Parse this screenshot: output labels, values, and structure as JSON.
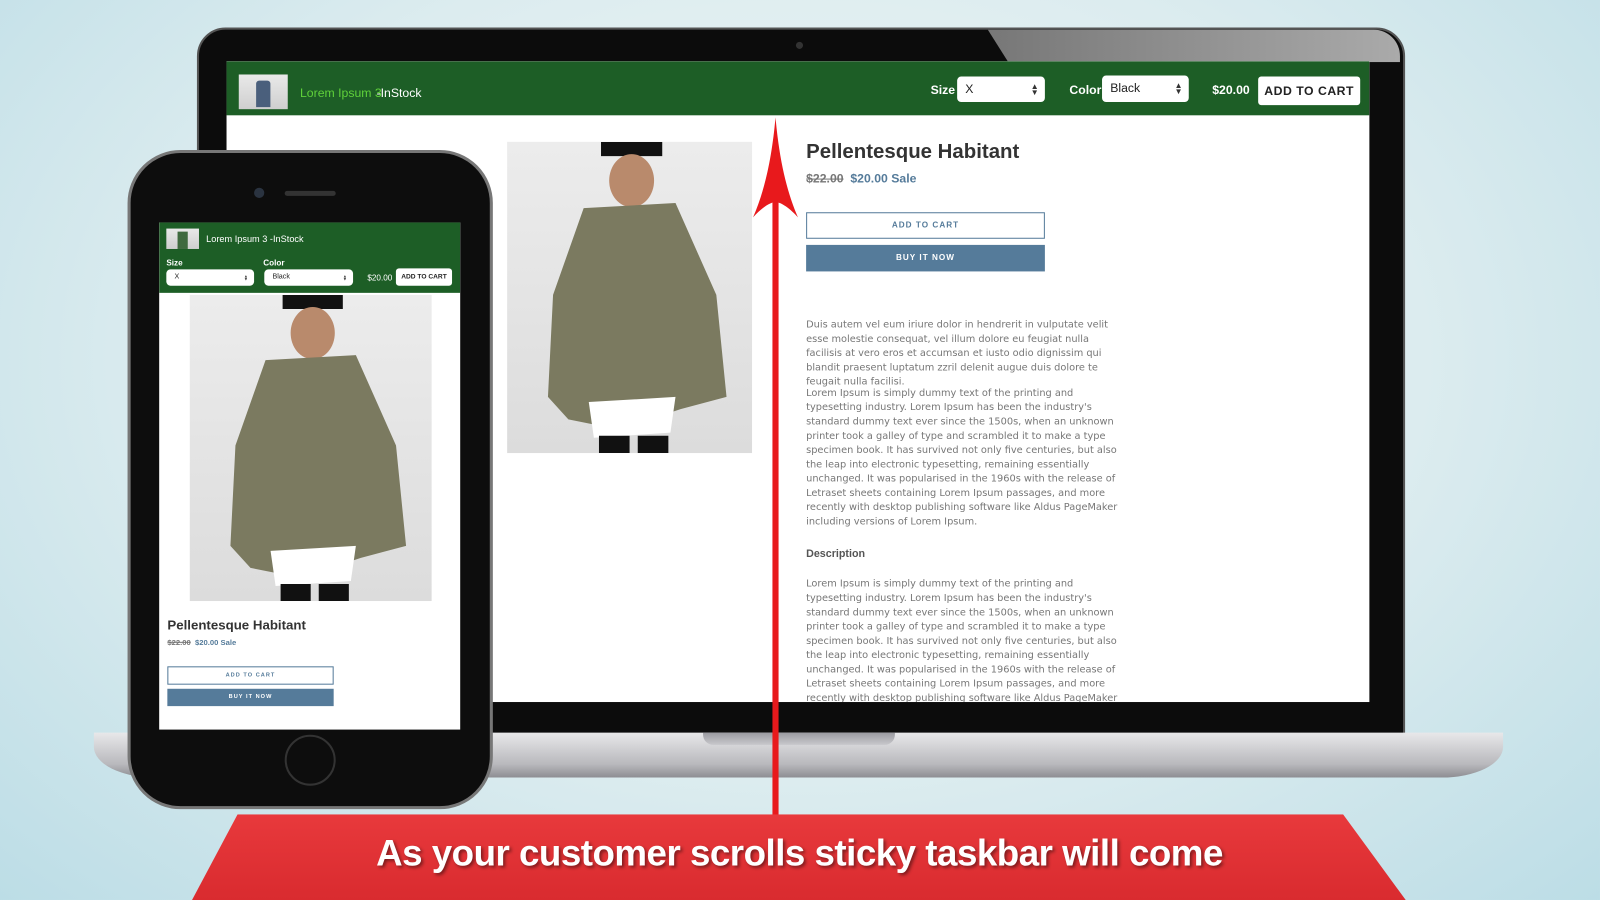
{
  "desktop": {
    "sticky_bar": {
      "product": "Lorem Ipsum 3",
      "stock": " -InStock",
      "size_label": "Size",
      "size_value": "X",
      "color_label": "Color",
      "color_value": "Black",
      "price": "$20.00",
      "add_to_cart": "ADD TO CART"
    },
    "product": {
      "title": "Pellentesque Habitant",
      "old_price": "$22.00",
      "price": "$20.00 Sale",
      "add_to_cart": "ADD TO CART",
      "buy_now": "BUY IT NOW",
      "para1": "Duis autem vel eum iriure dolor in hendrerit in vulputate velit esse molestie consequat, vel illum dolore eu feugiat nulla facilisis at vero eros et accumsan et iusto odio dignissim qui blandit praesent luptatum zzril delenit augue duis dolore te feugait nulla facilisi.",
      "para2": "Lorem Ipsum is simply dummy text of the printing and typesetting industry. Lorem Ipsum has been the industry's standard dummy text ever since the 1500s, when an unknown printer took a galley of type and scrambled it to make a type specimen book. It has survived not only five centuries, but also the leap into electronic typesetting, remaining essentially unchanged. It was popularised in the 1960s with the release of Letraset sheets containing Lorem Ipsum passages, and more recently with desktop publishing software like Aldus PageMaker including versions of Lorem Ipsum.",
      "description_heading": "Description",
      "para3": "Lorem Ipsum is simply dummy text of the printing and typesetting industry. Lorem Ipsum has been the industry's standard dummy text ever since the 1500s, when an unknown printer took a galley of type and scrambled it to make a type specimen book. It has survived not only five centuries, but also the leap into electronic typesetting, remaining essentially unchanged. It was popularised in the 1960s with the release of Letraset sheets containing Lorem Ipsum passages, and more recently with desktop publishing software like Aldus PageMaker including versions of Lorem Ipsum."
    }
  },
  "mobile": {
    "sticky_bar": {
      "title": "Lorem Ipsum 3 -InStock",
      "size_label": "Size",
      "size_value": "X",
      "color_label": "Color",
      "color_value": "Black",
      "price": "$20.00",
      "add_to_cart": "ADD TO CART"
    },
    "product": {
      "title": "Pellentesque Habitant",
      "old_price": "$22.00",
      "price": "$20.00 Sale",
      "add_to_cart": "ADD TO CART",
      "buy_now": "BUY IT NOW"
    }
  },
  "banner": {
    "text": "As your customer scrolls sticky taskbar will come"
  },
  "colors": {
    "sticky_bar": "#1d5e26",
    "accent_green": "#5fd13a",
    "button_blue": "#557b9a",
    "arrow_red": "#e8191c",
    "banner_red": "#e0302f"
  }
}
